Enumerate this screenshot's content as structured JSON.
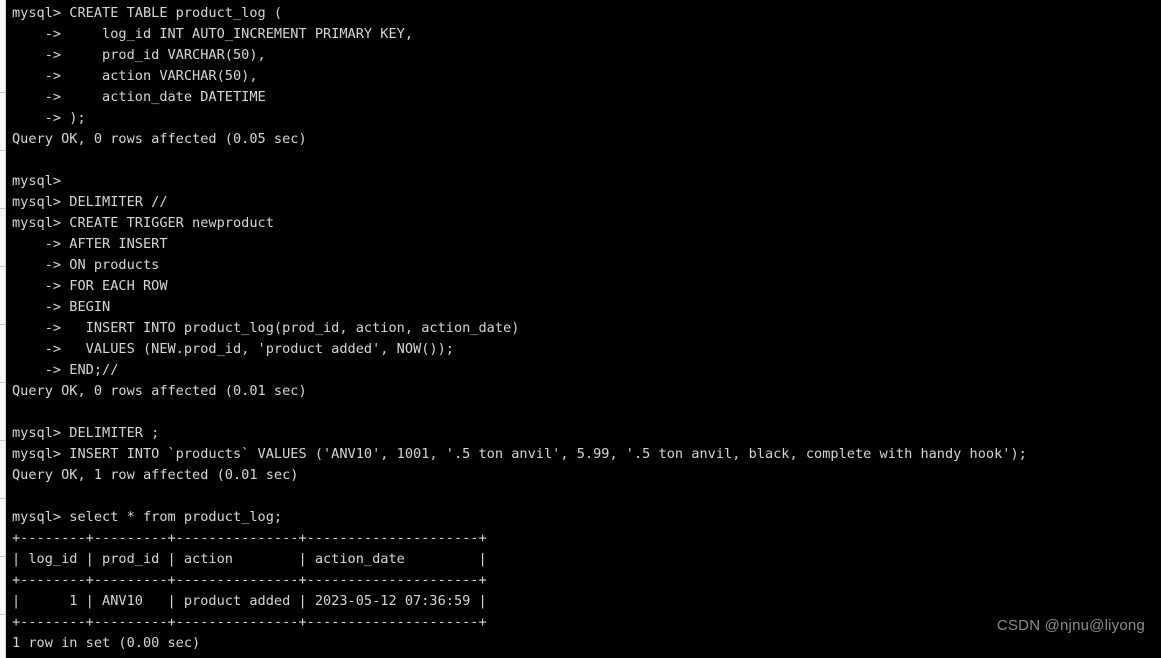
{
  "terminal": {
    "background_color": "#000000",
    "text_color": "#d6d6d6",
    "lines": [
      "mysql> CREATE TABLE product_log (",
      "    ->     log_id INT AUTO_INCREMENT PRIMARY KEY,",
      "    ->     prod_id VARCHAR(50),",
      "    ->     action VARCHAR(50),",
      "    ->     action_date DATETIME",
      "    -> );",
      "Query OK, 0 rows affected (0.05 sec)",
      "",
      "mysql>",
      "mysql> DELIMITER //",
      "mysql> CREATE TRIGGER newproduct",
      "    -> AFTER INSERT",
      "    -> ON products",
      "    -> FOR EACH ROW",
      "    -> BEGIN",
      "    ->   INSERT INTO product_log(prod_id, action, action_date)",
      "    ->   VALUES (NEW.prod_id, 'product added', NOW());",
      "    -> END;//",
      "Query OK, 0 rows affected (0.01 sec)",
      "",
      "mysql> DELIMITER ;",
      "mysql> INSERT INTO `products` VALUES ('ANV10', 1001, '.5 ton anvil', 5.99, '.5 ton anvil, black, complete with handy hook');",
      "Query OK, 1 row affected (0.01 sec)",
      "",
      "mysql> select * from product_log;",
      "+--------+---------+---------------+---------------------+",
      "| log_id | prod_id | action        | action_date         |",
      "+--------+---------+---------------+---------------------+",
      "|      1 | ANV10   | product added | 2023-05-12 07:36:59 |",
      "+--------+---------+---------------+---------------------+",
      "1 row in set (0.00 sec)"
    ]
  },
  "result_table": {
    "columns": [
      "log_id",
      "prod_id",
      "action",
      "action_date"
    ],
    "rows": [
      [
        "1",
        "ANV10",
        "product added",
        "2023-05-12 07:36:59"
      ]
    ],
    "row_count_text": "1 row in set (0.00 sec)"
  },
  "watermark": {
    "text": "CSDN @njnu@liyong",
    "color": "#8c8c8c"
  }
}
